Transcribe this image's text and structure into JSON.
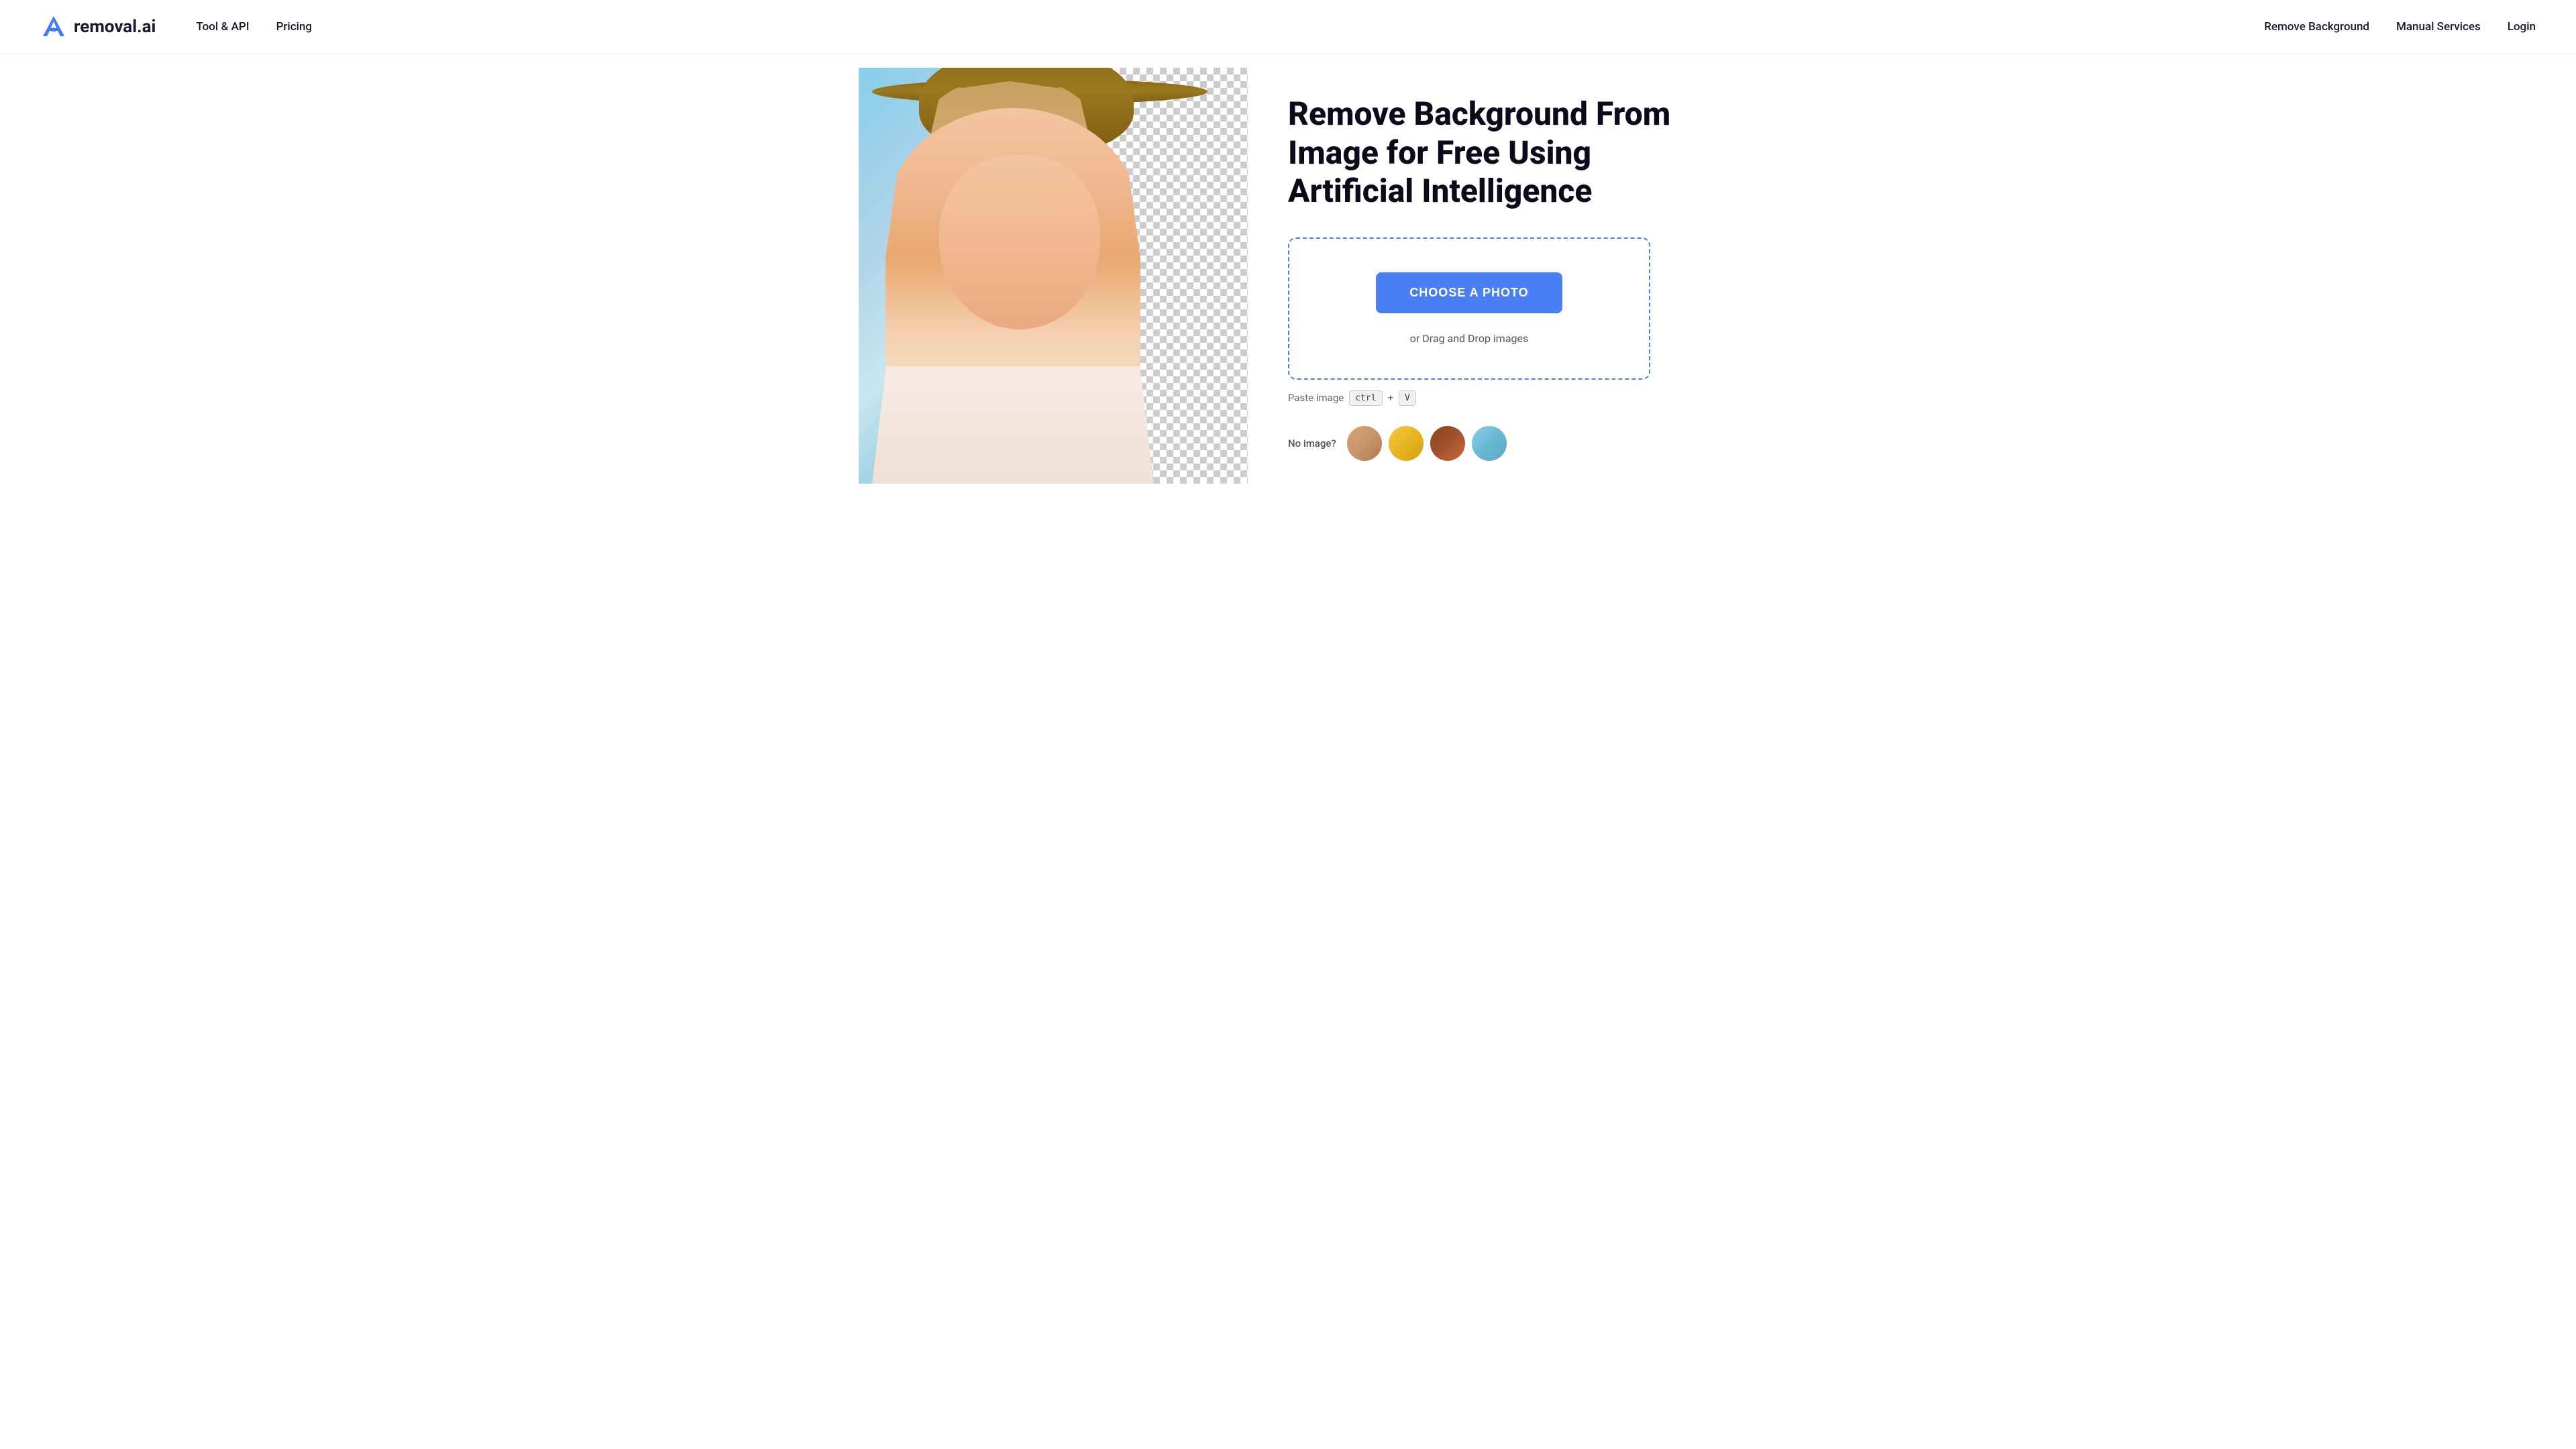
{
  "header": {
    "logo_text": "removal.ai",
    "nav": {
      "tool_api": "Tool & API",
      "pricing": "Pricing"
    },
    "secondary_nav": {
      "remove_background": "Remove Background",
      "manual_services": "Manual Services",
      "login": "Login"
    }
  },
  "hero": {
    "title": "Remove Background From Image for Free Using Artificial Intelligence",
    "upload": {
      "choose_button": "CHOOSE A PHOTO",
      "drag_drop": "or Drag and Drop images",
      "paste_hint": "Paste image",
      "ctrl_key": "ctrl",
      "plus": "+",
      "v_key": "V"
    },
    "no_image": {
      "label": "No image?"
    }
  }
}
